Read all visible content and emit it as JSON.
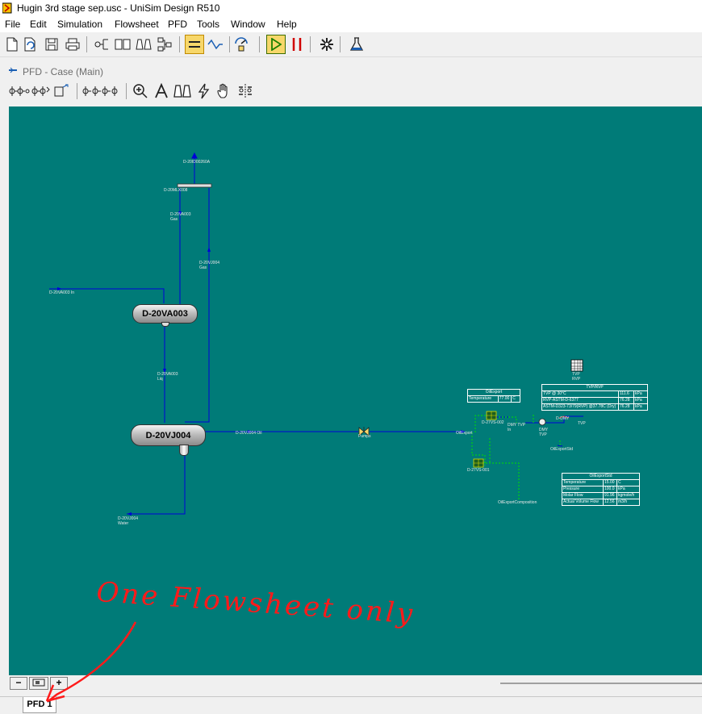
{
  "window": {
    "title": "Hugin 3rd stage sep.usc - UniSim Design R510"
  },
  "menu": [
    "File",
    "Edit",
    "Simulation",
    "Flowsheet",
    "PFD",
    "Tools",
    "Window",
    "Help"
  ],
  "toolbar_icons": [
    "new-case-icon",
    "open-case-icon",
    "save-icon",
    "print-icon",
    "workbook-icon",
    "open-book-icon",
    "binoculars-icon",
    "flowsheet-icon",
    "pfd-icon",
    "flow-icon",
    "properties-icon",
    "run-icon",
    "pause-icon",
    "snowflake-icon",
    "flask-icon"
  ],
  "child_window": {
    "title": "PFD - Case (Main)"
  },
  "pfd": {
    "vessels": {
      "v1": "D-20VA003",
      "v2": "D-20VJ004"
    },
    "labels": {
      "top_gas": "D-20ID00260A",
      "mixer": "D-20MLX008",
      "gas1": "D-20VA003\nGas",
      "gas2": "D-20VJ004\nGas",
      "feed": "D-20VA003 In",
      "liq": "D-20VA003\nLiq",
      "oil": "D-20VJ004 Oil",
      "valve": "Pumps",
      "oilexport": "OilExport",
      "water": "D-20VJ004\nWater",
      "comp1": "D-27VS-002",
      "comp2": "D-27VS-001",
      "dmytvp": "DMY TVP\nIn",
      "dmy": "D-DMY",
      "dmyout": "DMY\nTVP",
      "tvp": "TVP",
      "oilexportstd": "OilExportStd",
      "oilexportcomp": "OilExportComposition",
      "spread": "TVP\nRVP"
    },
    "tables": {
      "oilexport": {
        "title": "OilExport",
        "rows": [
          [
            "Temperature",
            "77.00",
            "C"
          ]
        ]
      },
      "tvprvp": {
        "title": "TVP/RVP",
        "rows": [
          [
            "TVP @ 30°C",
            "111.6",
            "kPa"
          ],
          [
            "RVP-ASTM-D-6377",
            "76.28",
            "kPa"
          ],
          [
            "ASTM-D323-73/79(RVP) @37.78C (Dry)",
            "76.28",
            "kPa"
          ]
        ]
      },
      "oilexportstd": {
        "title": "OilExportStd",
        "rows": [
          [
            "Temperature",
            "15.00",
            "C"
          ],
          [
            "Pressure",
            "100.0",
            "kPa"
          ],
          [
            "Molar Flow",
            "91.96",
            "kgmole/h"
          ],
          [
            "Actual Volume Flow",
            "12.56",
            "m3/h"
          ]
        ]
      }
    },
    "annotation": "One Flowsheet only"
  },
  "zoom_buttons": {
    "minus": "−",
    "plus": "+"
  },
  "tabs": {
    "pfd": "PFD 1"
  }
}
